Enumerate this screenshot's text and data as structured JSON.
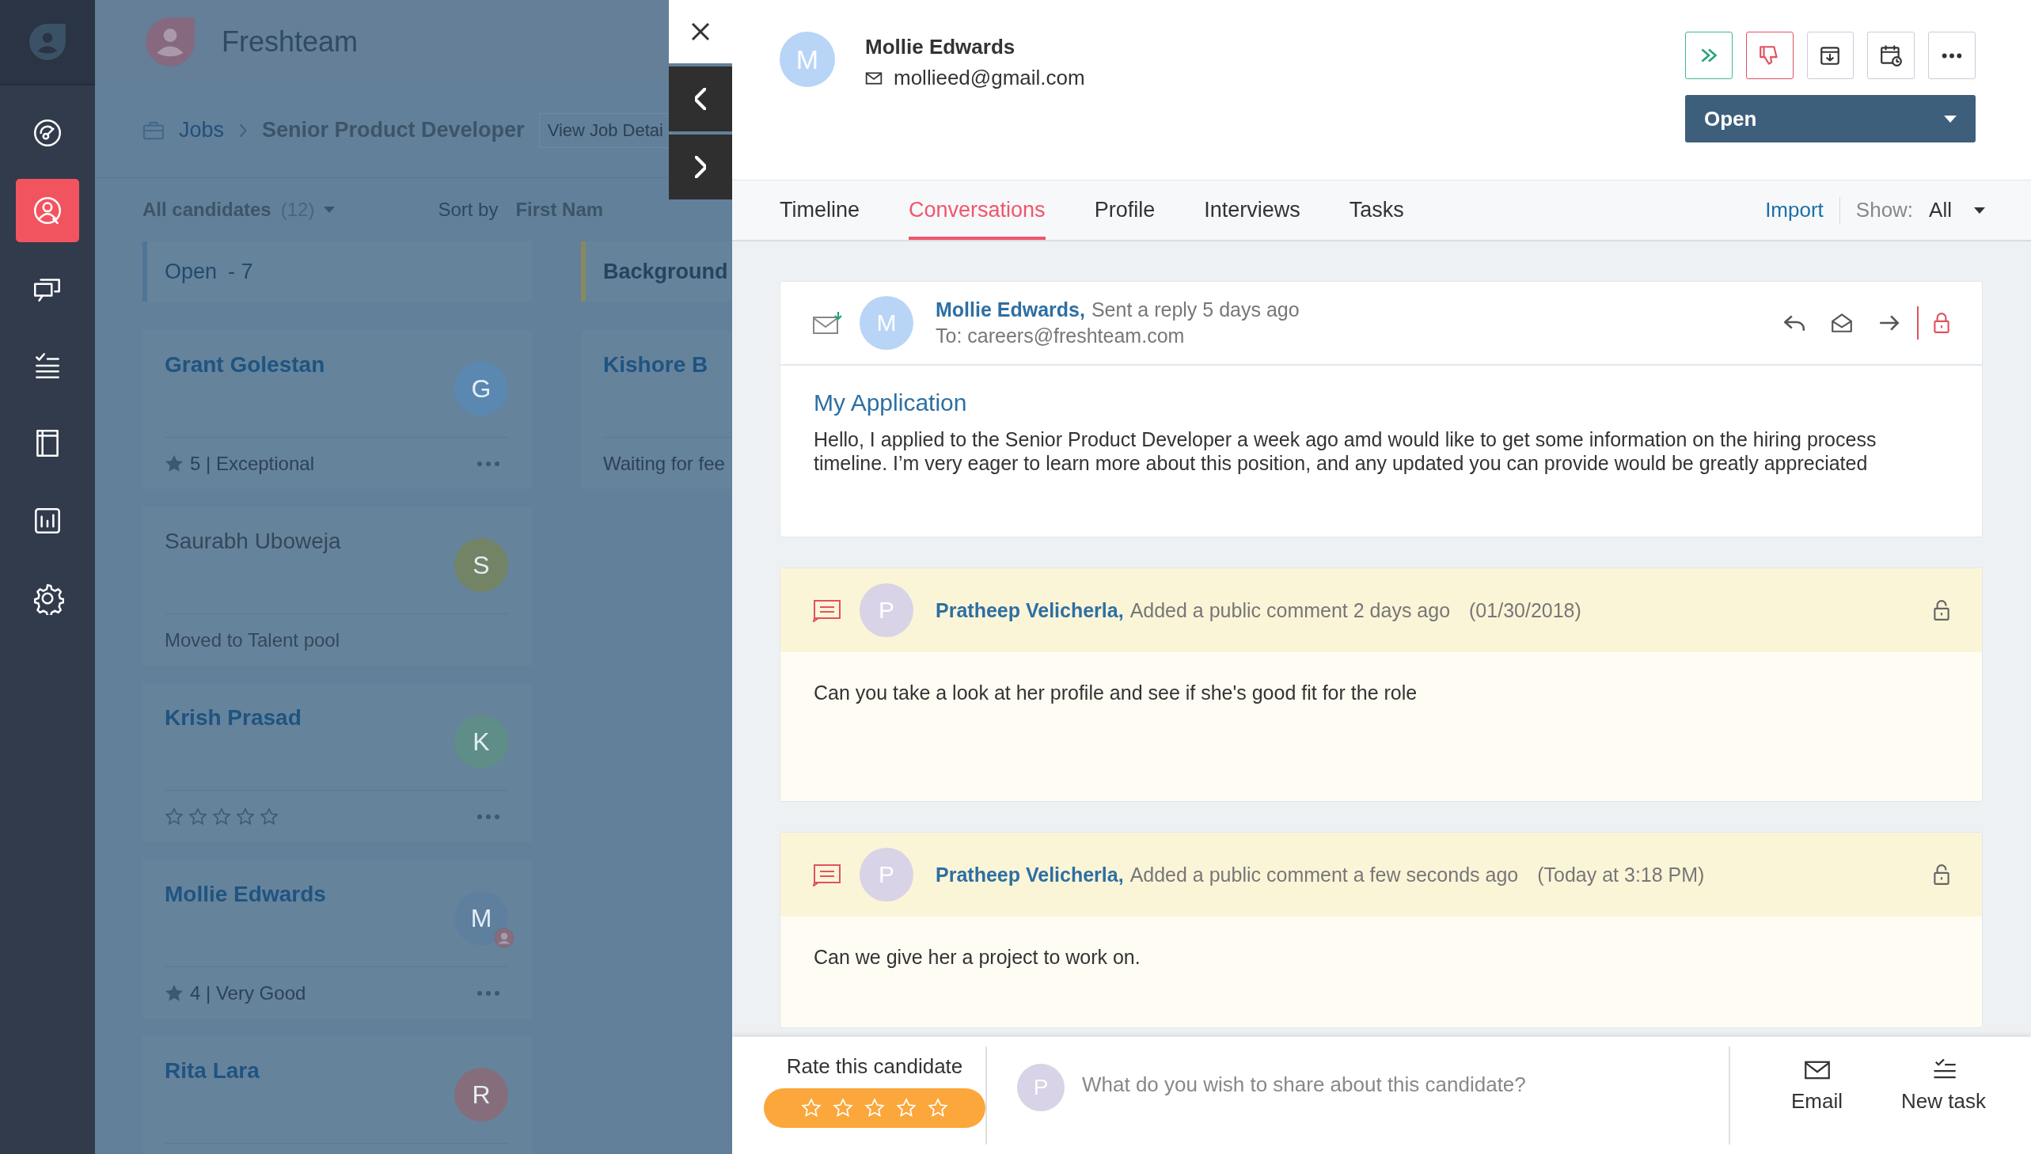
{
  "app": {
    "name": "Freshteam"
  },
  "sidebar": {
    "items": [
      {
        "selected": false
      },
      {
        "selected": true
      },
      {
        "selected": false
      },
      {
        "selected": false
      },
      {
        "selected": false
      },
      {
        "selected": false
      },
      {
        "selected": false
      }
    ]
  },
  "breadcrumb": {
    "items": [
      "Jobs",
      "Senior Product Developer"
    ],
    "view_link": "View Job Detai"
  },
  "filter": {
    "label": "All candidates",
    "count": "(12)",
    "sort_label": "Sort by",
    "sort_value": "First Nam"
  },
  "columns": [
    {
      "title": "Open",
      "count": "- 7",
      "color": "#4f7596",
      "cards": [
        {
          "name": "Grant Golestan",
          "avatar": "G",
          "color": "#5a88b0",
          "dimmed": false,
          "footer": {
            "kind": "rating",
            "text": "5 | Exceptional"
          }
        },
        {
          "name": "Saurabh Uboweja",
          "avatar": "S",
          "color": "#738466",
          "dimmed": true,
          "footer": {
            "kind": "status",
            "text": "Moved to Talent pool"
          }
        },
        {
          "name": "Krish Prasad",
          "avatar": "K",
          "color": "#5e8e87",
          "dimmed": false,
          "footer": {
            "kind": "stars",
            "stars": 0
          }
        },
        {
          "name": "Mollie Edwards",
          "avatar": "M",
          "color": "#5e7f9e",
          "dimmed": false,
          "badge": true,
          "footer": {
            "kind": "rating",
            "text": "4 | Very Good"
          }
        },
        {
          "name": "Rita Lara",
          "avatar": "R",
          "color": "#866d7b",
          "dimmed": false
        }
      ]
    },
    {
      "title": "Background",
      "color": "#87895f",
      "cards": [
        {
          "name": "Kishore B",
          "dimmed": false,
          "footer": {
            "kind": "status",
            "text": "Waiting for fee"
          }
        }
      ]
    }
  ],
  "candidate": {
    "initial": "M",
    "name": "Mollie Edwards",
    "email": "mollieed@gmail.com",
    "status": "Open"
  },
  "tabs": [
    {
      "label": "Timeline",
      "selected": false
    },
    {
      "label": "Conversations",
      "selected": true
    },
    {
      "label": "Profile",
      "selected": false
    },
    {
      "label": "Interviews",
      "selected": false
    },
    {
      "label": "Tasks",
      "selected": false
    }
  ],
  "import": "Import",
  "show": {
    "label": "Show:",
    "value": "All"
  },
  "messages": [
    {
      "kind": "email",
      "initial": "M",
      "author": "Mollie Edwards,",
      "action": "Sent a reply 5 days ago",
      "to": "To: careers@freshteam.com",
      "subject": "My Application",
      "body": "Hello, I applied to the Senior Product Developer a week ago amd would like to get some information on the hiring process timeline. I’m very eager to learn more about this position, and any updated you can provide would be greatly appreciated",
      "locked": true
    },
    {
      "kind": "comment",
      "initial": "P",
      "author": "Pratheep Velicherla,",
      "action": "Added a public comment 2 days ago",
      "date": "(01/30/2018)",
      "body": "Can you take a look at her profile and see if she's good fit for the role",
      "locked": false
    },
    {
      "kind": "comment",
      "initial": "P",
      "author": "Pratheep Velicherla,",
      "action": "Added a public comment a few seconds ago",
      "date": "(Today at 3:18 PM)",
      "body": "Can we give her a project to work on.",
      "locked": false
    }
  ],
  "composer": {
    "rate_label": "Rate this candidate",
    "stars": 0,
    "initial": "P",
    "placeholder": "What do you wish to share about this candidate?",
    "actions": [
      "Email",
      "New task"
    ]
  }
}
